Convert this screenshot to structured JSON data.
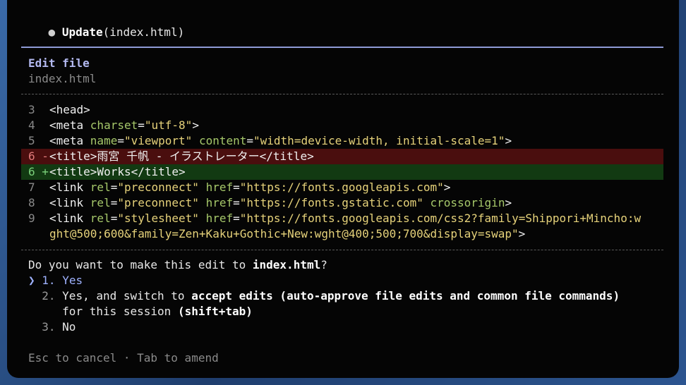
{
  "header": {
    "tool": "Update",
    "args": "(index.html)"
  },
  "panel": {
    "title": "Edit file",
    "filename": "index.html"
  },
  "diff": [
    {
      "num": "3",
      "kind": "context",
      "parts": [
        [
          "tag",
          "<head>"
        ]
      ]
    },
    {
      "num": "4",
      "kind": "context",
      "parts": [
        [
          "tag",
          "<meta "
        ],
        [
          "attr",
          "charset"
        ],
        [
          "tag",
          "="
        ],
        [
          "str",
          "\"utf-8\""
        ],
        [
          "tag",
          ">"
        ]
      ]
    },
    {
      "num": "5",
      "kind": "context",
      "parts": [
        [
          "tag",
          "<meta "
        ],
        [
          "attr",
          "name"
        ],
        [
          "tag",
          "="
        ],
        [
          "str",
          "\"viewport\""
        ],
        [
          "tag",
          " "
        ],
        [
          "attr",
          "content"
        ],
        [
          "tag",
          "="
        ],
        [
          "str",
          "\"width=device-width, initial-scale=1\""
        ],
        [
          "tag",
          ">"
        ]
      ]
    },
    {
      "num": "6",
      "kind": "removed",
      "marker": "-",
      "parts": [
        [
          "tag",
          "<title>雨宮 千帆 - イラストレーター</title>"
        ]
      ]
    },
    {
      "num": "6",
      "kind": "added",
      "marker": "+",
      "parts": [
        [
          "tag",
          "<title>Works</title>"
        ]
      ]
    },
    {
      "num": "7",
      "kind": "context",
      "parts": [
        [
          "tag",
          "<link "
        ],
        [
          "attr",
          "rel"
        ],
        [
          "tag",
          "="
        ],
        [
          "str",
          "\"preconnect\""
        ],
        [
          "tag",
          " "
        ],
        [
          "attr",
          "href"
        ],
        [
          "tag",
          "="
        ],
        [
          "str",
          "\"https://fonts.googleapis.com\""
        ],
        [
          "tag",
          ">"
        ]
      ]
    },
    {
      "num": "8",
      "kind": "context",
      "parts": [
        [
          "tag",
          "<link "
        ],
        [
          "attr",
          "rel"
        ],
        [
          "tag",
          "="
        ],
        [
          "str",
          "\"preconnect\""
        ],
        [
          "tag",
          " "
        ],
        [
          "attr",
          "href"
        ],
        [
          "tag",
          "="
        ],
        [
          "str",
          "\"https://fonts.gstatic.com\""
        ],
        [
          "tag",
          " "
        ],
        [
          "attr",
          "crossorigin"
        ],
        [
          "tag",
          ">"
        ]
      ]
    },
    {
      "num": "9",
      "kind": "context",
      "parts": [
        [
          "tag",
          "<link "
        ],
        [
          "attr",
          "rel"
        ],
        [
          "tag",
          "="
        ],
        [
          "str",
          "\"stylesheet\""
        ],
        [
          "tag",
          " "
        ],
        [
          "attr",
          "href"
        ],
        [
          "tag",
          "="
        ],
        [
          "str",
          "\"https://fonts.googleapis.com/css2?family=Shippori+Mincho:w"
        ]
      ]
    },
    {
      "num": "",
      "kind": "context",
      "parts": [
        [
          "str",
          "ght@500;600&family=Zen+Kaku+Gothic+New:wght@400;500;700&display=swap\""
        ],
        [
          "tag",
          ">"
        ]
      ]
    }
  ],
  "prompt": {
    "question_pre": "Do you want to make this edit to ",
    "question_file": "index.html",
    "question_post": "?",
    "selector": "❯",
    "options": [
      {
        "num": "1.",
        "label": "Yes"
      },
      {
        "num": "2.",
        "label_pre": "Yes, and switch to ",
        "label_bold": "accept edits (auto-approve file edits and common file commands)",
        "label_line2_pre": "for this session ",
        "label_line2_bold": "(shift+tab)"
      },
      {
        "num": "3.",
        "label": "No"
      }
    ],
    "footer": "Esc to cancel · Tab to amend"
  },
  "colors": {
    "accent": "#8e9ad6",
    "removed_bg": "#4a0e0e",
    "added_bg": "#123a12",
    "attr": "#a6c86a",
    "string": "#e6d27a"
  }
}
